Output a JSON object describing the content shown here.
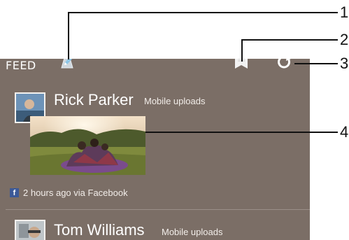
{
  "feed": {
    "title": "FEED",
    "icons": {
      "compose": "compose-pencil-icon",
      "notes": "notes-icon",
      "refresh": "refresh-icon"
    }
  },
  "posts": [
    {
      "name": "Rick Parker",
      "source": "Mobile uploads",
      "meta": "2 hours ago via Facebook",
      "network_badge": "f"
    },
    {
      "name": "Tom Williams",
      "source": "Mobile uploads"
    }
  ],
  "callouts": [
    "1",
    "2",
    "3",
    "4"
  ],
  "colors": {
    "panel": "#7b6e66",
    "facebook": "#3b5998",
    "text": "#ffffff"
  }
}
